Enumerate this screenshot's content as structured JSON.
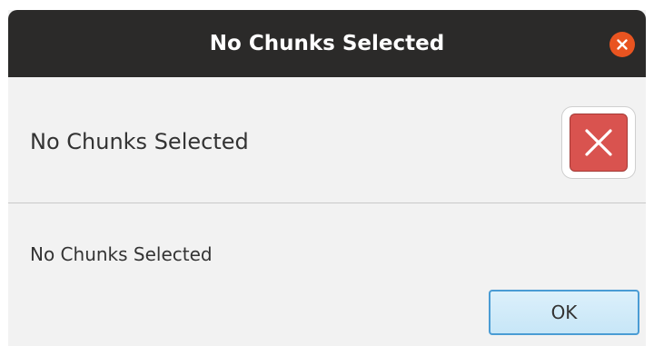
{
  "window": {
    "title": "No Chunks Selected",
    "close_icon": "close-icon"
  },
  "dialog": {
    "header_text": "No Chunks Selected",
    "icon": "error-icon",
    "content_text": "No Chunks Selected",
    "ok_label": "OK"
  },
  "colors": {
    "titlebar": "#2b2a29",
    "close_button": "#e95420",
    "error_icon": "#d9534f",
    "ok_border": "#4a9cd4",
    "background": "#f2f2f2"
  }
}
